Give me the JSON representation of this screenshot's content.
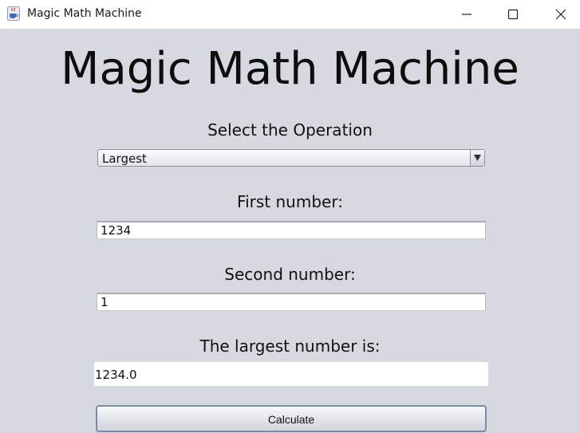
{
  "window": {
    "title": "Magic Math Machine",
    "icon": "java-coffee-cup-icon",
    "controls": [
      "minimize-icon",
      "maximize-icon",
      "close-icon"
    ]
  },
  "main": {
    "heading": "Magic Math Machine",
    "operation": {
      "label": "Select the Operation",
      "selected": "Largest"
    },
    "first": {
      "label": "First number:",
      "value": "1234"
    },
    "second": {
      "label": "Second number:",
      "value": "1"
    },
    "result": {
      "label": "The largest number is:",
      "value": "1234.0"
    },
    "calculate_label": "Calculate"
  },
  "colors": {
    "background": "#d6d9e0",
    "titlebar": "#ffffff",
    "button_border": "#7b8aa6"
  }
}
